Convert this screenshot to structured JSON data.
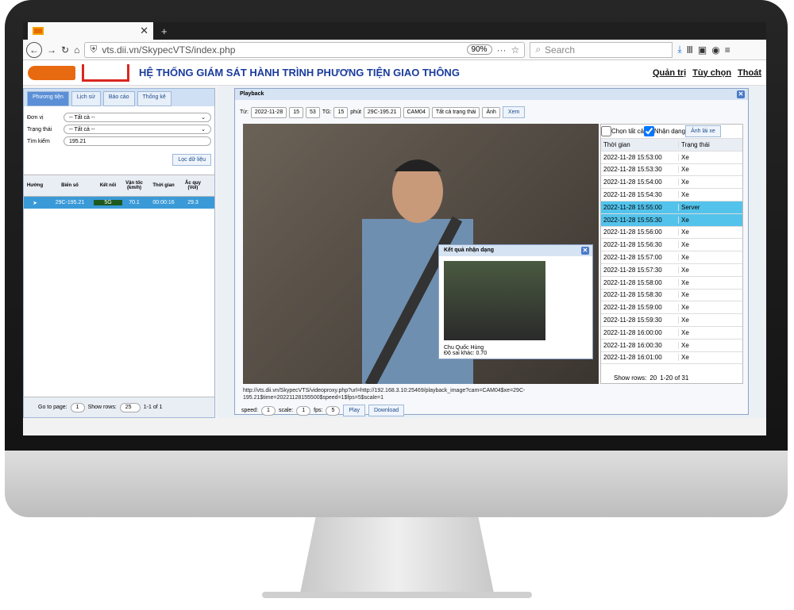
{
  "browser": {
    "tab_title": "",
    "new_tab": "+",
    "url": "vts.dii.vn/SkypecVTS/index.php",
    "zoom": "90%",
    "search_placeholder": "Search",
    "menu": "≡"
  },
  "app": {
    "title": "HỆ THỐNG GIÁM SÁT HÀNH TRÌNH PHƯƠNG TIỆN GIAO THÔNG",
    "links": [
      "Quản trị",
      "Tùy chọn",
      "Thoát"
    ]
  },
  "left": {
    "tabs": [
      "Phương tiện",
      "Lịch sử",
      "Báo cáo",
      "Thống kê"
    ],
    "filters": {
      "unit_label": "Đơn vị",
      "unit_value": "-- Tất cả --",
      "status_label": "Trạng thái",
      "status_value": "-- Tất cả --",
      "search_label": "Tìm kiếm",
      "search_value": "195.21",
      "filter_btn": "Lọc dữ liệu"
    },
    "columns": [
      "Hướng",
      "Biển số",
      "Kết nối",
      "Vận tốc (km/h)",
      "Thời gian",
      "Ắc quy (Vol)"
    ],
    "row": {
      "plate": "29C-195.21",
      "conn": "5G",
      "speed": "70.1",
      "time": "00:00:16",
      "battery": "29.3"
    },
    "pager": {
      "goto": "Go to page:",
      "page": "1",
      "show": "Show rows:",
      "rows": "25",
      "count": "1-1 of 1"
    }
  },
  "playback": {
    "title": "Playback",
    "from": "Từ:",
    "date": "2022-11-28",
    "hour": "15",
    "minute": "53",
    "tg_label": "TG:",
    "tg": "15",
    "phut": "phút",
    "plate": "29C-195.21",
    "cam": "CAM04",
    "state": "Tất cả trạng thái",
    "img": "Ảnh",
    "view": "Xem",
    "select_all": "Chọn tất cả",
    "recog": "Nhận dạng",
    "img_btn": "Ảnh lái xe",
    "col_time": "Thời gian",
    "col_state": "Trạng thái",
    "rows": [
      [
        "2022-11-28 15:53:00",
        "Xe"
      ],
      [
        "2022-11-28 15:53:30",
        "Xe"
      ],
      [
        "2022-11-28 15:54:00",
        "Xe"
      ],
      [
        "2022-11-28 15:54:30",
        "Xe"
      ],
      [
        "2022-11-28 15:55:00",
        "Server"
      ],
      [
        "2022-11-28 15:55:30",
        "Xe"
      ],
      [
        "2022-11-28 15:56:00",
        "Xe"
      ],
      [
        "2022-11-28 15:56:30",
        "Xe"
      ],
      [
        "2022-11-28 15:57:00",
        "Xe"
      ],
      [
        "2022-11-28 15:57:30",
        "Xe"
      ],
      [
        "2022-11-28 15:58:00",
        "Xe"
      ],
      [
        "2022-11-28 15:58:30",
        "Xe"
      ],
      [
        "2022-11-28 15:59:00",
        "Xe"
      ],
      [
        "2022-11-28 15:59:30",
        "Xe"
      ],
      [
        "2022-11-28 16:00:00",
        "Xe"
      ],
      [
        "2022-11-28 16:00:30",
        "Xe"
      ],
      [
        "2022-11-28 16:01:00",
        "Xe"
      ]
    ],
    "list_show": "Show rows:",
    "list_rows": "20",
    "list_count": "1-20 of 31",
    "url": "http://vts.dii.vn/SkypecVTS/videoproxy.php?url=http://192.168.3.10:25469/playback_image?cam=CAM04$xe=29C-195.21$time=20221128155500$speed=1$fps=5$scale=1",
    "speed_label": "speed:",
    "speed": "1",
    "scale_label": "scale:",
    "scale": "1",
    "fps_label": "fps:",
    "fps": "5",
    "play": "Play",
    "download": "Download"
  },
  "popup": {
    "title": "Kết quả nhận dạng",
    "name": "Chu Quốc Hùng",
    "error": "Độ sai khác: 0.70"
  }
}
